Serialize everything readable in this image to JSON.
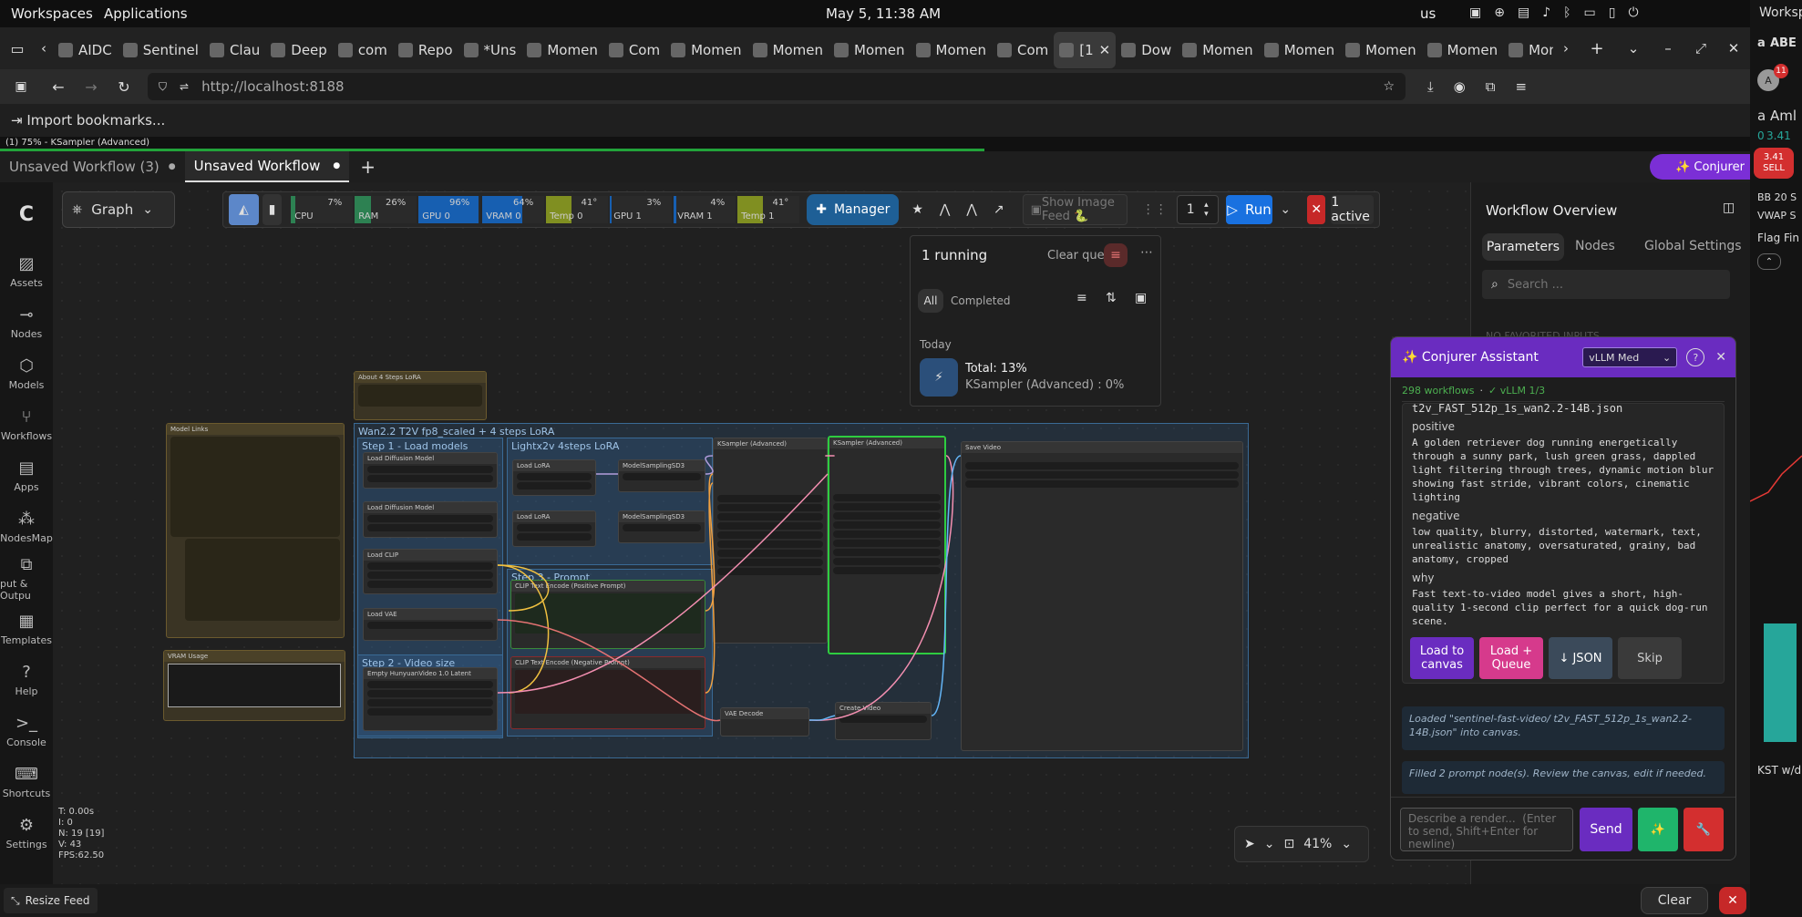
{
  "os": {
    "workspaces": "Workspaces",
    "applications": "Applications",
    "datetime": "May 5, 11:38 AM",
    "kb_layout": "us"
  },
  "browser": {
    "tabs": [
      {
        "label": "AIDC"
      },
      {
        "label": "Sentinel"
      },
      {
        "label": "Clau"
      },
      {
        "label": "Deep"
      },
      {
        "label": "com"
      },
      {
        "label": "Repo"
      },
      {
        "label": "*Uns"
      },
      {
        "label": "Momen"
      },
      {
        "label": "Com"
      },
      {
        "label": "Momen"
      },
      {
        "label": "Momen"
      },
      {
        "label": "Momen"
      },
      {
        "label": "Momen"
      },
      {
        "label": "Com"
      },
      {
        "label": "[1"
      },
      {
        "label": "Dow"
      },
      {
        "label": "Momen"
      },
      {
        "label": "Momen"
      },
      {
        "label": "Momen"
      },
      {
        "label": "Momen"
      },
      {
        "label": "Momen"
      }
    ],
    "url": "http://localhost:8188",
    "bookmarks_import": "Import bookmarks..."
  },
  "progress": {
    "label": "(1) 75% - KSampler (Advanced)",
    "percent": 75
  },
  "workflow_tabs": [
    {
      "label": "Unsaved Workflow (3)"
    },
    {
      "label": "Unsaved Workflow"
    }
  ],
  "conjurer_button": "✨ Conjurer",
  "toolbar": {
    "graph_label": "Graph",
    "monitors": [
      {
        "name": "CPU",
        "value": "7%",
        "fill": 0.07,
        "color": "#2e8b57"
      },
      {
        "name": "RAM",
        "value": "26%",
        "fill": 0.26,
        "color": "#2e8b57"
      },
      {
        "name": "GPU 0",
        "value": "96%",
        "fill": 0.96,
        "color": "#1565c0"
      },
      {
        "name": "VRAM 0",
        "value": "64%",
        "fill": 0.64,
        "color": "#1565c0"
      },
      {
        "name": "Temp 0",
        "value": "41°",
        "fill": 0.41,
        "color": "#8a9a20"
      },
      {
        "name": "GPU 1",
        "value": "3%",
        "fill": 0.03,
        "color": "#1565c0"
      },
      {
        "name": "VRAM 1",
        "value": "4%",
        "fill": 0.04,
        "color": "#1565c0"
      },
      {
        "name": "Temp 1",
        "value": "41°",
        "fill": 0.41,
        "color": "#8a9a20"
      }
    ],
    "manager_label": "Manager",
    "show_image_feed": "Show Image Feed 🐍",
    "batch_count": "1",
    "run_label": "Run",
    "active_label": "1 active"
  },
  "sidebar": [
    {
      "label": "Assets",
      "icon": "image-icon"
    },
    {
      "label": "Nodes",
      "icon": "link-icon"
    },
    {
      "label": "Models",
      "icon": "cube-icon"
    },
    {
      "label": "Workflows",
      "icon": "workflow-icon"
    },
    {
      "label": "Apps",
      "icon": "apps-icon"
    },
    {
      "label": "NodesMap",
      "icon": "map-icon"
    },
    {
      "label": "put & Outpu",
      "icon": "io-icon"
    },
    {
      "label": "Templates",
      "icon": "template-icon"
    },
    {
      "label": "Help",
      "icon": "help-icon"
    },
    {
      "label": "Console",
      "icon": "console-icon"
    },
    {
      "label": "Shortcuts",
      "icon": "keyboard-icon"
    },
    {
      "label": "Settings",
      "icon": "gear-icon"
    }
  ],
  "queue": {
    "running": "1 running",
    "clear_queue": "Clear queue",
    "tab_all": "All",
    "tab_completed": "Completed",
    "today": "Today",
    "total": "Total: 13%",
    "job": "KSampler (Advanced) : 0%"
  },
  "stats": {
    "t": "T: 0.00s",
    "i": "I: 0",
    "n": "N: 19 [19]",
    "v": "V: 43",
    "fps": "FPS:62.50"
  },
  "zoom": "41%",
  "overview": {
    "title": "Workflow Overview",
    "tabs": [
      "Parameters",
      "Nodes",
      "Global Settings"
    ],
    "search_placeholder": "Search ...",
    "faded": "NO FAVORITED INPUTS"
  },
  "assistant": {
    "title": "✨ Conjurer Assistant",
    "model": "vLLM Med",
    "workflows": "298 workflows",
    "vllm": "✓ vLLM 1/3",
    "file_line": "t2v_FAST_512p_1s_wan2.2-14B.json",
    "positive_label": "positive",
    "positive_text": "A golden retriever dog running energetically through a sunny park, lush green grass, dappled light filtering through trees, dynamic motion blur showing fast stride, vibrant colors, cinematic lighting",
    "negative_label": "negative",
    "negative_text": "low quality, blurry, distorted, watermark, text, unrealistic anatomy, oversaturated, grainy, bad anatomy, cropped",
    "why_label": "why",
    "why_text": "Fast text-to-video model gives a short, high-quality 1-second clip perfect for a quick dog-run scene.",
    "buttons": {
      "load_canvas": "Load to canvas",
      "load_queue": "Load + Queue",
      "json": "↓ JSON",
      "skip": "Skip"
    },
    "msg1": "Loaded \"sentinel-fast-video/ t2v_FAST_512p_1s_wan2.2-14B.json\" into canvas.",
    "msg2": "Filled 2 prompt node(s). Review the canvas, edit if needed.",
    "input_placeholder": "Describe a render...  (Enter to send, Shift+Enter for newline)",
    "send": "Send"
  },
  "bottom": {
    "resize_feed": "Resize Feed",
    "clear": "Clear"
  },
  "right_extra": {
    "workspaces": "Worksp",
    "badge": "11",
    "ticker": "ABE",
    "name": "Aml",
    "price": "3.41",
    "change": "0",
    "sell_price": "3.41",
    "sell": "SELL",
    "bb": "BB 20 S",
    "vwap": "VWAP S",
    "flag": "Flag Fin",
    "kst": "KST w/d"
  },
  "canvas": {
    "groups": [
      {
        "title": "Wan2.2 T2V fp8_scaled + 4 steps LoRA"
      },
      {
        "title": "Step 1 - Load models"
      },
      {
        "title": "Lightx2v 4steps LoRA"
      },
      {
        "title": "Step 3 - Prompt"
      },
      {
        "title": "Step 2 - Video size"
      }
    ],
    "nodes": [
      {
        "title": "About 4 Steps LoRA"
      },
      {
        "title": "Model Links"
      },
      {
        "title": "VRAM Usage"
      },
      {
        "title": "Load Diffusion Model"
      },
      {
        "title": "Load Diffusion Model"
      },
      {
        "title": "Load CLIP"
      },
      {
        "title": "Load VAE"
      },
      {
        "title": "Load LoRA"
      },
      {
        "title": "Load LoRA"
      },
      {
        "title": "ModelSamplingSD3"
      },
      {
        "title": "ModelSamplingSD3"
      },
      {
        "title": "KSampler (Advanced)"
      },
      {
        "title": "KSampler (Advanced)"
      },
      {
        "title": "Save Video"
      },
      {
        "title": "CLIP Text Encode (Positive Prompt)"
      },
      {
        "title": "CLIP Text Encode (Negative Prompt)"
      },
      {
        "title": "Empty HunyuanVideo 1.0 Latent"
      },
      {
        "title": "VAE Decode"
      },
      {
        "title": "Create Video"
      }
    ]
  }
}
